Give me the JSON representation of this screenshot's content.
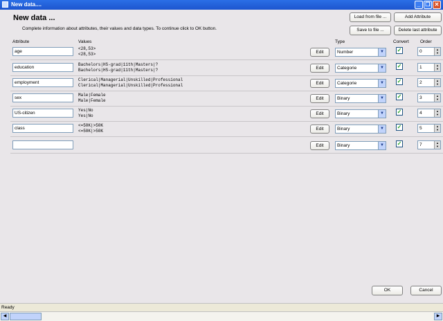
{
  "window": {
    "title": "New data....",
    "min": "_",
    "max": "❐",
    "close": "✕"
  },
  "header": {
    "title": "New data ...",
    "subtitle": "Complete information about attributes, their values and data types. To continue click to OK button."
  },
  "buttons": {
    "load_from_file": "Load from file ...",
    "add_attribute": "Add Attribute",
    "save_to_file": "Save to file ...",
    "delete_last_attribute": "Delete last attribute",
    "ok": "OK",
    "cancel": "Cancel"
  },
  "columns": {
    "attribute": "Attribute",
    "values": "Values",
    "type": "Type",
    "convert": "Convert",
    "order": "Order"
  },
  "rows": [
    {
      "attribute": "age",
      "values": "<28,53>\n<28,53>",
      "edit": "Edit",
      "type": "Number",
      "convert": true,
      "order": "0"
    },
    {
      "attribute": "education",
      "values": "Bachelors|HS-grad|11th|Masters|?\nBachelors|HS-grad|11th|Masters|?",
      "edit": "Edit",
      "type": "Categorie",
      "convert": true,
      "order": "1"
    },
    {
      "attribute": "employment",
      "values": "Clerical|Managerial|Unskilled|Professional\nClerical|Managerial|Unskilled|Professional",
      "edit": "Edit",
      "type": "Categorie",
      "convert": true,
      "order": "2"
    },
    {
      "attribute": "sex",
      "values": "Male|Female\nMale|Female",
      "edit": "Edit",
      "type": "Binary",
      "convert": true,
      "order": "3"
    },
    {
      "attribute": "US-citizen",
      "values": "Yes|No\nYes|No",
      "edit": "Edit",
      "type": "Binary",
      "convert": true,
      "order": "4"
    },
    {
      "attribute": "class",
      "values": "<=50K|>50K\n<=50K|>50K",
      "edit": "Edit",
      "type": "Binary",
      "convert": true,
      "order": "5"
    },
    {
      "attribute": "",
      "values": "",
      "edit": "Edit",
      "type": "Binary",
      "convert": true,
      "order": "7"
    }
  ],
  "status": {
    "text": "Ready"
  },
  "icons": {
    "checkbox": "check-icon",
    "dropdown": "chevron-down-icon",
    "spinner": "spin-icon"
  }
}
